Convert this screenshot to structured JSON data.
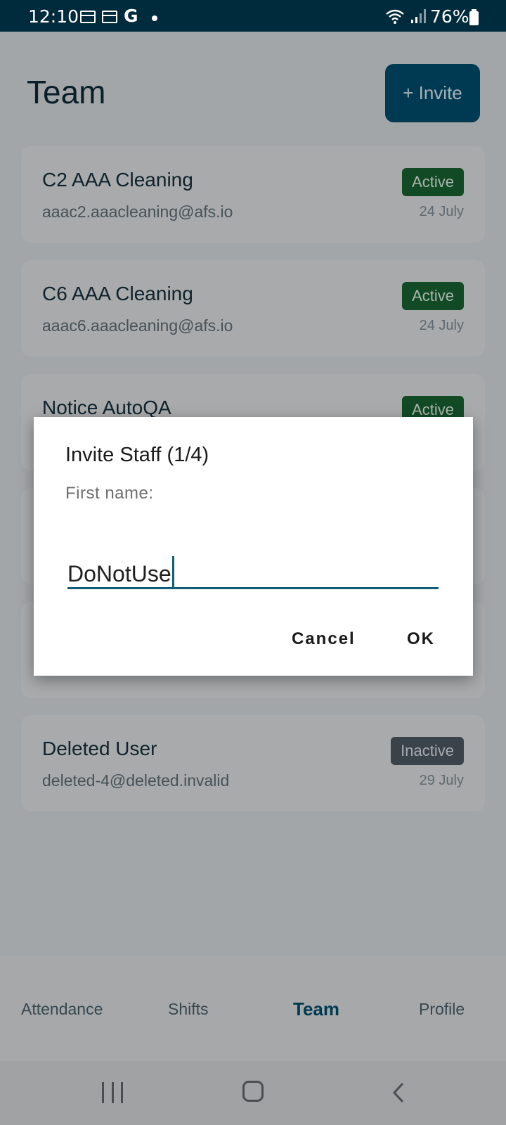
{
  "status_bar": {
    "time": "12:10",
    "google_glyph": "G",
    "battery": "76%"
  },
  "header": {
    "title": "Team",
    "invite_label": "+ Invite"
  },
  "members": [
    {
      "name": "C2 AAA Cleaning",
      "email": "aaac2.aaacleaning@afs.io",
      "status": "Active",
      "date": "24 July"
    },
    {
      "name": "C6 AAA Cleaning",
      "email": "aaac6.aaacleaning@afs.io",
      "status": "Active",
      "date": "24 July"
    },
    {
      "name": "Notice AutoQA",
      "email": "",
      "status": "Active",
      "date": ""
    },
    {
      "name": "Deleted User",
      "email": "deleted-4@deleted.invalid",
      "status": "Inactive",
      "date": "29 July"
    }
  ],
  "dialog": {
    "title": "Invite Staff (1/4)",
    "label": "First name:",
    "value": "DoNotUse",
    "cancel": "Cancel",
    "ok": "OK"
  },
  "bottom_nav": {
    "items": [
      "Attendance",
      "Shifts",
      "Team",
      "Profile"
    ],
    "active": "Team"
  },
  "colors": {
    "primary": "#003a52",
    "active_badge": "#134a26",
    "inactive_badge": "#3b434a",
    "input_underline": "#0f5d7a"
  }
}
